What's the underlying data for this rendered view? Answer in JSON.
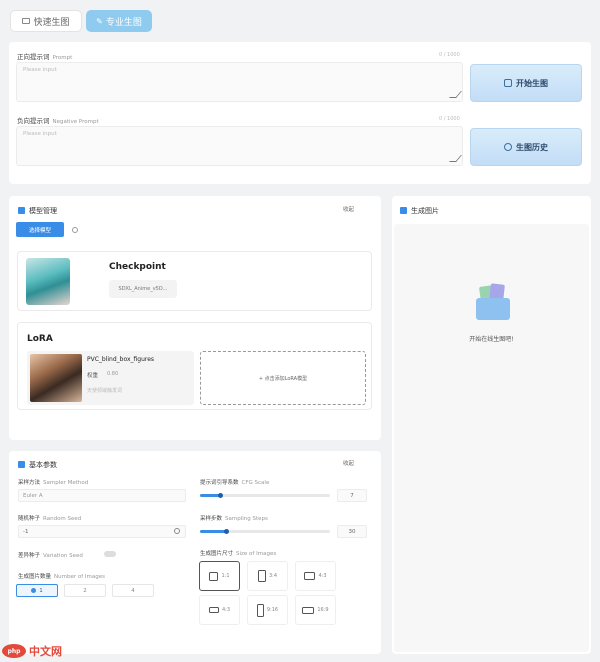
{
  "tabs": {
    "quick": "快速生图",
    "pro": "专业生图"
  },
  "prompt": {
    "positive_label": "正向提示词",
    "positive_sub": "Prompt",
    "positive_placeholder": "Please input",
    "positive_count": "0 / 1000",
    "negative_label": "负向提示词",
    "negative_sub": "Negative Prompt",
    "negative_placeholder": "Please input",
    "negative_count": "0 / 1000"
  },
  "actions": {
    "start": "开始生图",
    "history": "生图历史"
  },
  "model": {
    "title": "模型管理",
    "collapse": "收起",
    "select_model_btn": "选择模型",
    "checkpoint_title": "Checkpoint",
    "checkpoint_name": "SDXL_Anime_v5D...",
    "lora_title": "LoRA",
    "lora_name": "PVC_blind_box_figures",
    "lora_weight_label": "权重",
    "lora_weight_value": "0.80",
    "lora_trigger": "天使领域触发词",
    "add_lora": "+ 点击添加LoRA模型"
  },
  "output": {
    "title": "生成图片",
    "empty_text": "开始在线生图吧!"
  },
  "params": {
    "title": "基本参数",
    "collapse": "收起",
    "sampler_label": "采样方法",
    "sampler_sub": "Sampler Method",
    "sampler_value": "Euler A",
    "cfg_label": "提示词引导系数",
    "cfg_sub": "CFG Scale",
    "cfg_value": "7",
    "cfg_fraction": 0.15,
    "seed_label": "随机种子",
    "seed_sub": "Random Seed",
    "seed_value": "-1",
    "steps_label": "采样步数",
    "steps_sub": "Sampling Steps",
    "steps_value": "30",
    "steps_fraction": 0.2,
    "variation_label": "差异种子",
    "variation_sub": "Variation Seed",
    "num_label": "生成图片数量",
    "num_sub": "Number of Images",
    "num_options": [
      "1",
      "2",
      "4"
    ],
    "size_label": "生成图片尺寸",
    "size_sub": "Size of Images",
    "ratios": [
      "1:1",
      "3:4",
      "4:3",
      "4:3",
      "9:16",
      "16:9"
    ]
  },
  "watermark": "中文网"
}
